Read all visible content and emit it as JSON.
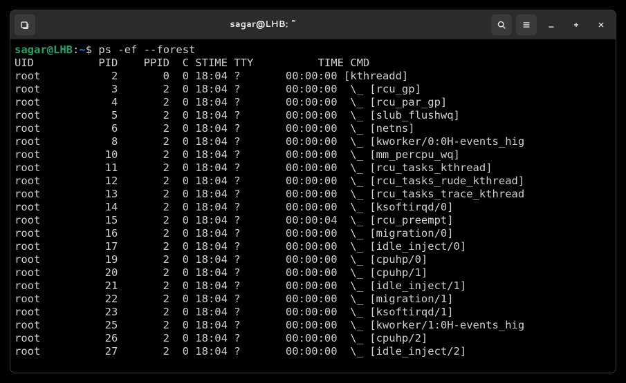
{
  "window": {
    "title": "sagar@LHB: ~"
  },
  "prompt": {
    "user": "sagar",
    "host": "LHB",
    "path": "~",
    "symbol": "$",
    "command": "ps -ef --forest"
  },
  "header": "UID          PID    PPID  C STIME TTY          TIME CMD",
  "rows": [
    {
      "uid": "root",
      "pid": 2,
      "ppid": 0,
      "c": 0,
      "stime": "18:04",
      "tty": "?",
      "time": "00:00:00",
      "cmd": "[kthreadd]"
    },
    {
      "uid": "root",
      "pid": 3,
      "ppid": 2,
      "c": 0,
      "stime": "18:04",
      "tty": "?",
      "time": "00:00:00",
      "cmd": " \\_ [rcu_gp]"
    },
    {
      "uid": "root",
      "pid": 4,
      "ppid": 2,
      "c": 0,
      "stime": "18:04",
      "tty": "?",
      "time": "00:00:00",
      "cmd": " \\_ [rcu_par_gp]"
    },
    {
      "uid": "root",
      "pid": 5,
      "ppid": 2,
      "c": 0,
      "stime": "18:04",
      "tty": "?",
      "time": "00:00:00",
      "cmd": " \\_ [slub_flushwq]"
    },
    {
      "uid": "root",
      "pid": 6,
      "ppid": 2,
      "c": 0,
      "stime": "18:04",
      "tty": "?",
      "time": "00:00:00",
      "cmd": " \\_ [netns]"
    },
    {
      "uid": "root",
      "pid": 8,
      "ppid": 2,
      "c": 0,
      "stime": "18:04",
      "tty": "?",
      "time": "00:00:00",
      "cmd": " \\_ [kworker/0:0H-events_hig"
    },
    {
      "uid": "root",
      "pid": 10,
      "ppid": 2,
      "c": 0,
      "stime": "18:04",
      "tty": "?",
      "time": "00:00:00",
      "cmd": " \\_ [mm_percpu_wq]"
    },
    {
      "uid": "root",
      "pid": 11,
      "ppid": 2,
      "c": 0,
      "stime": "18:04",
      "tty": "?",
      "time": "00:00:00",
      "cmd": " \\_ [rcu_tasks_kthread]"
    },
    {
      "uid": "root",
      "pid": 12,
      "ppid": 2,
      "c": 0,
      "stime": "18:04",
      "tty": "?",
      "time": "00:00:00",
      "cmd": " \\_ [rcu_tasks_rude_kthread]"
    },
    {
      "uid": "root",
      "pid": 13,
      "ppid": 2,
      "c": 0,
      "stime": "18:04",
      "tty": "?",
      "time": "00:00:00",
      "cmd": " \\_ [rcu_tasks_trace_kthread"
    },
    {
      "uid": "root",
      "pid": 14,
      "ppid": 2,
      "c": 0,
      "stime": "18:04",
      "tty": "?",
      "time": "00:00:00",
      "cmd": " \\_ [ksoftirqd/0]"
    },
    {
      "uid": "root",
      "pid": 15,
      "ppid": 2,
      "c": 0,
      "stime": "18:04",
      "tty": "?",
      "time": "00:00:04",
      "cmd": " \\_ [rcu_preempt]"
    },
    {
      "uid": "root",
      "pid": 16,
      "ppid": 2,
      "c": 0,
      "stime": "18:04",
      "tty": "?",
      "time": "00:00:00",
      "cmd": " \\_ [migration/0]"
    },
    {
      "uid": "root",
      "pid": 17,
      "ppid": 2,
      "c": 0,
      "stime": "18:04",
      "tty": "?",
      "time": "00:00:00",
      "cmd": " \\_ [idle_inject/0]"
    },
    {
      "uid": "root",
      "pid": 19,
      "ppid": 2,
      "c": 0,
      "stime": "18:04",
      "tty": "?",
      "time": "00:00:00",
      "cmd": " \\_ [cpuhp/0]"
    },
    {
      "uid": "root",
      "pid": 20,
      "ppid": 2,
      "c": 0,
      "stime": "18:04",
      "tty": "?",
      "time": "00:00:00",
      "cmd": " \\_ [cpuhp/1]"
    },
    {
      "uid": "root",
      "pid": 21,
      "ppid": 2,
      "c": 0,
      "stime": "18:04",
      "tty": "?",
      "time": "00:00:00",
      "cmd": " \\_ [idle_inject/1]"
    },
    {
      "uid": "root",
      "pid": 22,
      "ppid": 2,
      "c": 0,
      "stime": "18:04",
      "tty": "?",
      "time": "00:00:00",
      "cmd": " \\_ [migration/1]"
    },
    {
      "uid": "root",
      "pid": 23,
      "ppid": 2,
      "c": 0,
      "stime": "18:04",
      "tty": "?",
      "time": "00:00:00",
      "cmd": " \\_ [ksoftirqd/1]"
    },
    {
      "uid": "root",
      "pid": 25,
      "ppid": 2,
      "c": 0,
      "stime": "18:04",
      "tty": "?",
      "time": "00:00:00",
      "cmd": " \\_ [kworker/1:0H-events_hig"
    },
    {
      "uid": "root",
      "pid": 26,
      "ppid": 2,
      "c": 0,
      "stime": "18:04",
      "tty": "?",
      "time": "00:00:00",
      "cmd": " \\_ [cpuhp/2]"
    },
    {
      "uid": "root",
      "pid": 27,
      "ppid": 2,
      "c": 0,
      "stime": "18:04",
      "tty": "?",
      "time": "00:00:00",
      "cmd": " \\_ [idle_inject/2]"
    }
  ]
}
